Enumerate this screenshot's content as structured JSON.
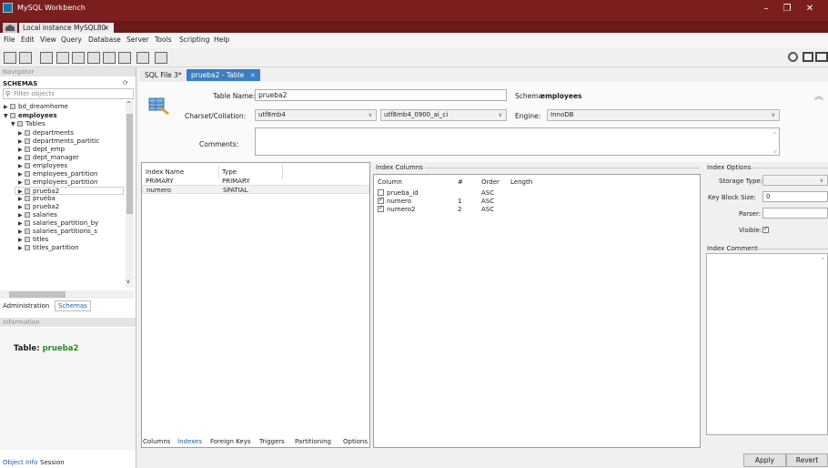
{
  "window": {
    "title": "MySQL Workbench",
    "minimize": "–",
    "maximize": "❐",
    "close": "✕"
  },
  "instance_tab": {
    "label": "Local instance MySQL80",
    "close": "×"
  },
  "menu": [
    "File",
    "Edit",
    "View",
    "Query",
    "Database",
    "Server",
    "Tools",
    "Scripting",
    "Help"
  ],
  "navigator": {
    "header": "Navigator",
    "schemas_label": "SCHEMAS",
    "filter_placeholder": "Filter objects",
    "tree": {
      "bd_dreamhome": "bd_dreamhome",
      "employees": "employees",
      "tables": "Tables",
      "items": [
        "departments",
        "departments_partitic",
        "dept_emp",
        "dept_manager",
        "employees",
        "employees_partition",
        "employees_partition",
        "prueba2",
        "prueba",
        "prueba2",
        "salaries",
        "salaries_partition_by",
        "salaries_partitions_s",
        "titles",
        "titles_partition"
      ]
    },
    "tabs": {
      "administration": "Administration",
      "schemas": "Schemas"
    },
    "info_header": "Information",
    "info_table_label": "Table:",
    "info_table_name": "prueba2",
    "footer_tabs": {
      "object_info": "Object Info",
      "session": "Session"
    }
  },
  "doc_tabs": {
    "sql": "SQL File 3*",
    "table": "prueba2 - Table",
    "close": "×"
  },
  "table_editor": {
    "table_name_label": "Table Name:",
    "table_name": "prueba2",
    "schema_label": "Schema:",
    "schema": "employees",
    "charset_label": "Charset/Collation:",
    "charset": "utf8mb4",
    "collation": "utf8mb4_0900_ai_ci",
    "engine_label": "Engine:",
    "engine": "InnoDB",
    "comments_label": "Comments:"
  },
  "indexes": {
    "headers": {
      "name": "Index Name",
      "type": "Type"
    },
    "rows": [
      {
        "name": "PRIMARY",
        "type": "PRIMARY"
      },
      {
        "name": "numero",
        "type": "SPATIAL"
      }
    ]
  },
  "index_columns": {
    "title": "Index Columns",
    "headers": {
      "column": "Column",
      "num": "#",
      "order": "Order",
      "length": "Length"
    },
    "rows": [
      {
        "column": "prueba_id",
        "num": "",
        "order": "ASC",
        "checked": false
      },
      {
        "column": "numero",
        "num": "1",
        "order": "ASC",
        "checked": true
      },
      {
        "column": "numero2",
        "num": "2",
        "order": "ASC",
        "checked": true
      }
    ]
  },
  "index_options": {
    "title": "Index Options",
    "storage_type_label": "Storage Type:",
    "key_block_label": "Key Block Size:",
    "key_block_value": "0",
    "parser_label": "Parser:",
    "visible_label": "Visible:",
    "comment_label": "Index Comment"
  },
  "bottom_tabs": [
    "Columns",
    "Indexes",
    "Foreign Keys",
    "Triggers",
    "Partitioning",
    "Options"
  ],
  "buttons": {
    "apply": "Apply",
    "revert": "Revert"
  }
}
